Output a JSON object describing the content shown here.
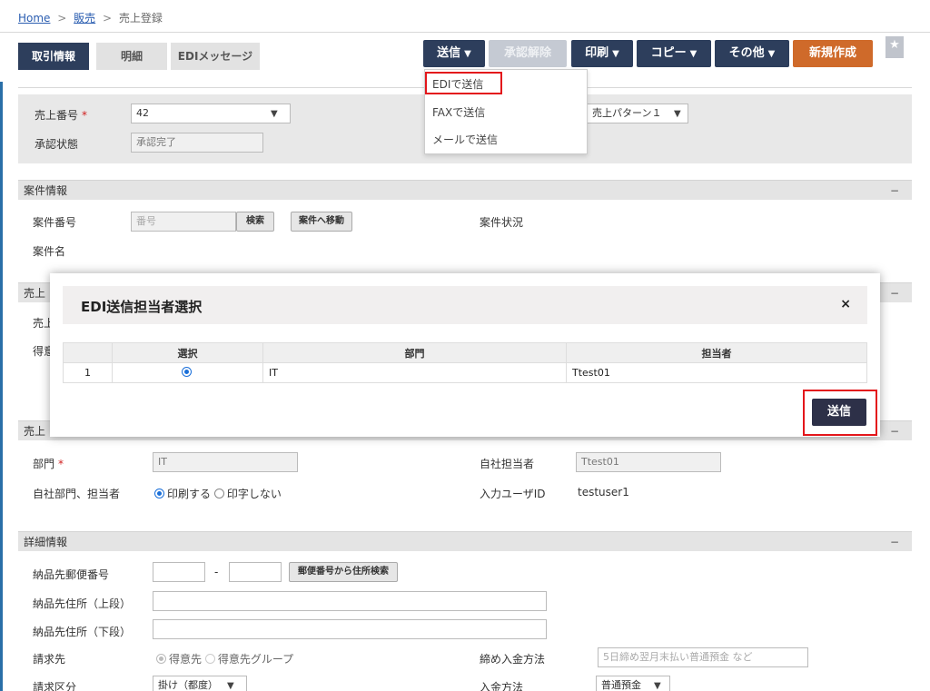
{
  "breadcrumb": {
    "home": "Home",
    "sep1": ">",
    "sales": "販売",
    "sep2": ">",
    "current": "売上登録"
  },
  "tabs": {
    "deal_info": "取引情報",
    "details": "明細",
    "edi_message": "EDIメッセージ"
  },
  "toolbar": {
    "send": "送信",
    "approve_cancel": "承認解除",
    "print": "印刷",
    "copy": "コピー",
    "other": "その他",
    "new": "新規作成",
    "caret": "▼"
  },
  "send_menu": {
    "edi": "EDIで送信",
    "fax": "FAXで送信",
    "mail": "メールで送信"
  },
  "header_panel": {
    "sales_number_label": "売上番号",
    "required_mark": "*",
    "sales_number_value": "42",
    "approval_status_label": "承認状態",
    "approval_status_value": "承認完了",
    "pattern_value": "売上パターン１"
  },
  "case_section": {
    "title": "案件情報",
    "collapse": "−",
    "case_number_label": "案件番号",
    "case_number_placeholder": "番号",
    "search_button": "検索",
    "goto_case_button": "案件へ移動",
    "case_status_label": "案件状況",
    "case_name_label": "案件名"
  },
  "sales_section": {
    "title_partial": "売上",
    "row1_partial": "売上",
    "row2_partial": "得意",
    "collapse": "−"
  },
  "owner_section": {
    "title_partial": "売上",
    "collapse": "−",
    "dept_label": "部門",
    "dept_value": "IT",
    "own_staff_label": "自社担当者",
    "own_staff_value": "Ttest01",
    "print_label": "自社部門、担当者",
    "print_yes": "印刷する",
    "print_no": "印字しない",
    "input_user_label": "入力ユーザID",
    "input_user_value": "testuser1"
  },
  "detail_section": {
    "title": "詳細情報",
    "collapse": "−",
    "postal_label": "納品先郵便番号",
    "postal_dash": "-",
    "postal_search_button": "郵便番号から住所検索",
    "address_upper_label": "納品先住所（上段）",
    "address_lower_label": "納品先住所（下段）",
    "billing_label": "請求先",
    "billing_customer": "得意先",
    "billing_group": "得意先グループ",
    "closing_label": "締め入金方法",
    "closing_placeholder": "5日締め翌月末払い普通預金 など",
    "billing_type_label": "請求区分",
    "billing_type_value": "掛け（都度）",
    "payment_method_label": "入金方法",
    "payment_method_value": "普通預金"
  },
  "modal": {
    "title": "EDI送信担当者選択",
    "close": "×",
    "columns": {
      "select": "選択",
      "dept": "部門",
      "staff": "担当者"
    },
    "rows": [
      {
        "no": "1",
        "dept": "IT",
        "staff": "Ttest01"
      }
    ],
    "send_button": "送信"
  },
  "colors": {
    "accent_dark": "#2d3e5c",
    "orange": "#cf6a2a",
    "highlight_red": "#e3161b"
  }
}
